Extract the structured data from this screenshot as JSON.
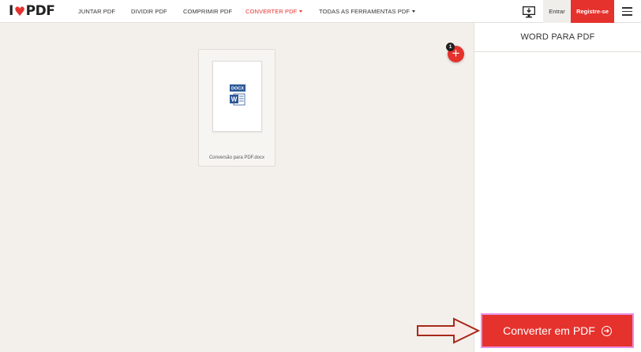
{
  "header": {
    "logo_text_i": "I",
    "logo_text_pdf": "PDF",
    "nav": [
      {
        "label": "JUNTAR PDF"
      },
      {
        "label": "DIVIDIR PDF"
      },
      {
        "label": "COMPRIMIR PDF"
      },
      {
        "label": "CONVERTER PDF"
      },
      {
        "label": "TODAS AS FERRAMENTAS PDF"
      }
    ],
    "login_label": "Entrar",
    "signup_label": "Registre-se"
  },
  "workspace": {
    "file": {
      "name": "Conversão para PDF.docx",
      "type_label": "DOCX",
      "icon": "word-document-icon"
    },
    "file_count": "1"
  },
  "sidebar": {
    "title": "WORD PARA PDF",
    "convert_label": "Converter em PDF"
  },
  "colors": {
    "brand": "#e5322d",
    "highlight": "#e98ee2",
    "annotation_arrow": "#a52a1a"
  }
}
